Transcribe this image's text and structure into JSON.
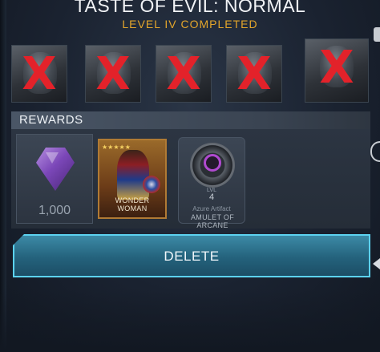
{
  "header": {
    "title": "TASTE OF EVIL: NORMAL",
    "subtitle": "LEVEL IV COMPLETED"
  },
  "defeated": {
    "count": 5,
    "mark": "X",
    "mark_color": "#e3222a"
  },
  "rewards": {
    "header": "REWARDS",
    "gems": {
      "icon": "purple-gem-icon",
      "quantity": "1,000"
    },
    "hero_card": {
      "name": "WONDER WOMAN",
      "stars": "★★★★★"
    },
    "artifact": {
      "icon": "amulet-artifact-icon",
      "level_label": "LVL",
      "level": "4",
      "type": "Azure Artifact",
      "name": "AMULET OF ARCANE"
    }
  },
  "actions": {
    "delete_label": "DELETE"
  },
  "colors": {
    "accent": "#e3a52b",
    "button": "#24627c",
    "button_border": "#5cd2f0"
  }
}
